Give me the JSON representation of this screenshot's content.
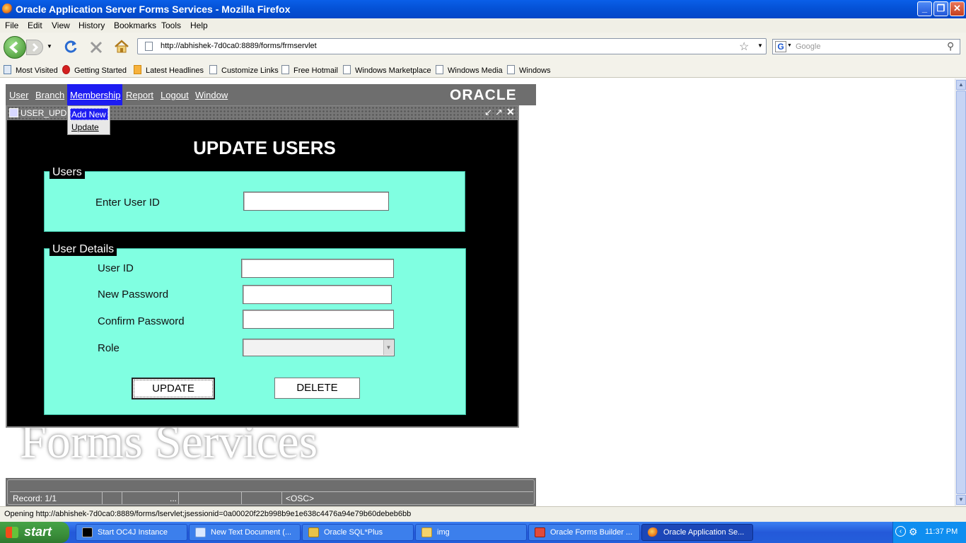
{
  "browser": {
    "title": "Oracle Application Server Forms Services - Mozilla Firefox",
    "menu": [
      "File",
      "Edit",
      "View",
      "History",
      "Bookmarks",
      "Tools",
      "Help"
    ],
    "url": "http://abhishek-7d0ca0:8889/forms/frmservlet",
    "search_placeholder": "Google",
    "bookmarks": [
      "Most Visited",
      "Getting Started",
      "Latest Headlines",
      "Customize Links",
      "Free Hotmail",
      "Windows Marketplace",
      "Windows Media",
      "Windows"
    ],
    "status_text": "Opening http://abhishek-7d0ca0:8889/forms/lservlet;jsessionid=0a00020f22b998b9e1e638c4476a94e79b60debeb6bb",
    "window_buttons": {
      "minimize": "_",
      "maximize": "❐",
      "close": "✕"
    }
  },
  "app": {
    "menu": [
      "User",
      "Branch",
      "Membership",
      "Report",
      "Logout",
      "Window"
    ],
    "logo": "ORACLE",
    "dropdown": {
      "add_new": "Add New",
      "update": "Update"
    },
    "window_title": "USER_UPD",
    "heading": "UPDATE USERS",
    "users_section": {
      "title": "Users",
      "user_id_label": "Enter User ID",
      "user_id_value": ""
    },
    "details_section": {
      "title": "User Details",
      "user_id_label": "User ID",
      "user_id_value": "",
      "new_password_label": "New Password",
      "new_password_value": "",
      "confirm_password_label": "Confirm Password",
      "confirm_password_value": "",
      "role_label": "Role",
      "role_value": ""
    },
    "buttons": {
      "update": "UPDATE",
      "delete": "DELETE"
    },
    "background_text": "Forms Services",
    "status": {
      "record": "Record: 1/1",
      "dots": "...",
      "osc": "<OSC>"
    }
  },
  "taskbar": {
    "start": "start",
    "items": [
      "Start OC4J Instance",
      "New Text Document (...",
      "Oracle SQL*Plus",
      "img",
      "Oracle Forms Builder ...",
      "Oracle Application Se..."
    ],
    "clock": "11:37 PM"
  },
  "colors": {
    "panel": "#80ffe1",
    "menu_highlight": "#1d1cf2",
    "title_blue": "#0553d8"
  }
}
